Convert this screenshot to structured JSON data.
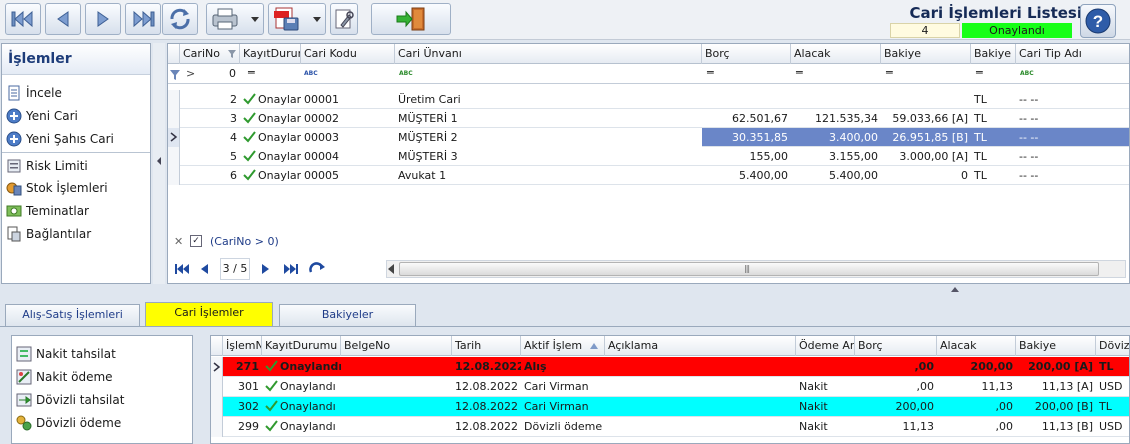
{
  "header": {
    "title": "Cari İşlemleri Listesi",
    "record_count": "4",
    "status": "Onaylandı",
    "status_color": "#17ff17"
  },
  "toolbar": {
    "buttons": [
      "first-record-icon",
      "previous-record-icon",
      "next-record-icon",
      "last-record-icon",
      "refresh-icon",
      "print-icon",
      "export-pdf-icon",
      "tools-icon",
      "exit-icon",
      "help-icon"
    ]
  },
  "sidebar": {
    "title": "İşlemler",
    "items": [
      {
        "label": "İncele",
        "icon": "document-icon"
      },
      {
        "label": "Yeni Cari",
        "icon": "add-icon"
      },
      {
        "label": "Yeni Şahıs Cari",
        "icon": "add-icon"
      },
      {
        "label": "Risk Limiti",
        "icon": "risk-icon"
      },
      {
        "label": "Stok İşlemleri",
        "icon": "stock-icon"
      },
      {
        "label": "Teminatlar",
        "icon": "guarantee-icon"
      },
      {
        "label": "Bağlantılar",
        "icon": "connections-icon"
      }
    ]
  },
  "cari_grid": {
    "columns": [
      "CariNo",
      "KayıtDurumu",
      "Cari Kodu",
      "Cari Ünvanı",
      "Borç",
      "Alacak",
      "Bakiye",
      "Bakiye D",
      "Cari Tip Adı"
    ],
    "filter_row": {
      "carino": "0"
    },
    "rows": [
      {
        "carino": "2",
        "durum": "Onaylar",
        "kod": "00001",
        "unvan": "Üretim Cari",
        "borc": "",
        "alacak": "",
        "bakiye": "",
        "bakiye_d": "TL",
        "tip": "-- --"
      },
      {
        "carino": "3",
        "durum": "Onaylar",
        "kod": "00002",
        "unvan": "MÜŞTERİ 1",
        "borc": "62.501,67",
        "alacak": "121.535,34",
        "bakiye": "59.033,66 [A]",
        "bakiye_d": "TL",
        "tip": "-- --"
      },
      {
        "carino": "4",
        "durum": "Onaylar",
        "kod": "00003",
        "unvan": "MÜŞTERİ 2",
        "borc": "30.351,85",
        "alacak": "3.400,00",
        "bakiye": "26.951,85 [B]",
        "bakiye_d": "TL",
        "tip": "-- --"
      },
      {
        "carino": "5",
        "durum": "Onaylar",
        "kod": "00004",
        "unvan": "MÜŞTERİ 3",
        "borc": "155,00",
        "alacak": "3.155,00",
        "bakiye": "3.000,00 [A]",
        "bakiye_d": "TL",
        "tip": "-- --"
      },
      {
        "carino": "6",
        "durum": "Onaylar",
        "kod": "00005",
        "unvan": "Avukat 1",
        "borc": "5.400,00",
        "alacak": "5.400,00",
        "bakiye": "0",
        "bakiye_d": "TL",
        "tip": "-- --"
      }
    ],
    "filter_text": "(CariNo > 0)",
    "pager": "3 / 5"
  },
  "tabs": [
    {
      "label": "Alış-Satış İşlemleri"
    },
    {
      "label": "Cari İşlemler"
    },
    {
      "label": "Bakiyeler"
    }
  ],
  "islem_panel": {
    "items": [
      {
        "label": "Nakit tahsilat",
        "icon": "cash-in-icon"
      },
      {
        "label": "Nakit ödeme",
        "icon": "cash-out-icon"
      },
      {
        "label": "Dövizli tahsilat",
        "icon": "currency-in-icon"
      },
      {
        "label": "Dövizli ödeme",
        "icon": "currency-out-icon"
      }
    ]
  },
  "islem_grid": {
    "columns": [
      "İşlemNo",
      "KayıtDurumu",
      "BelgeNo",
      "Tarih",
      "Aktif İşlem",
      "Açıklama",
      "Ödeme Aracı",
      "Borç",
      "Alacak",
      "Bakiye",
      "Döviz"
    ],
    "rows": [
      {
        "no": "271",
        "durum": "Onaylandı",
        "belge": "",
        "tarih": "12.08.2022",
        "islem": "Alış",
        "aciklama": "",
        "odeme": "",
        "borc": ",00",
        "alacak": "200,00",
        "bakiye": "200,00 [A]",
        "doviz": "TL",
        "bg": "#ff0000"
      },
      {
        "no": "301",
        "durum": "Onaylandı",
        "belge": "",
        "tarih": "12.08.2022 1",
        "islem": "Cari Virman",
        "aciklama": "",
        "odeme": "Nakit",
        "borc": ",00",
        "alacak": "11,13",
        "bakiye": "11,13 [A]",
        "doviz": "USD",
        "bg": "#ffffff"
      },
      {
        "no": "302",
        "durum": "Onaylandı",
        "belge": "",
        "tarih": "12.08.2022 1",
        "islem": "Cari Virman",
        "aciklama": "",
        "odeme": "Nakit",
        "borc": "200,00",
        "alacak": ",00",
        "bakiye": "200,00 [B]",
        "doviz": "TL",
        "bg": "#00ffff"
      },
      {
        "no": "299",
        "durum": "Onaylandı",
        "belge": "",
        "tarih": "12.08.2022 1",
        "islem": "Dövizli ödeme",
        "aciklama": "",
        "odeme": "Nakit",
        "borc": "11,13",
        "alacak": ",00",
        "bakiye": "11,13 [B]",
        "doviz": "USD",
        "bg": "#ffffff"
      }
    ]
  }
}
